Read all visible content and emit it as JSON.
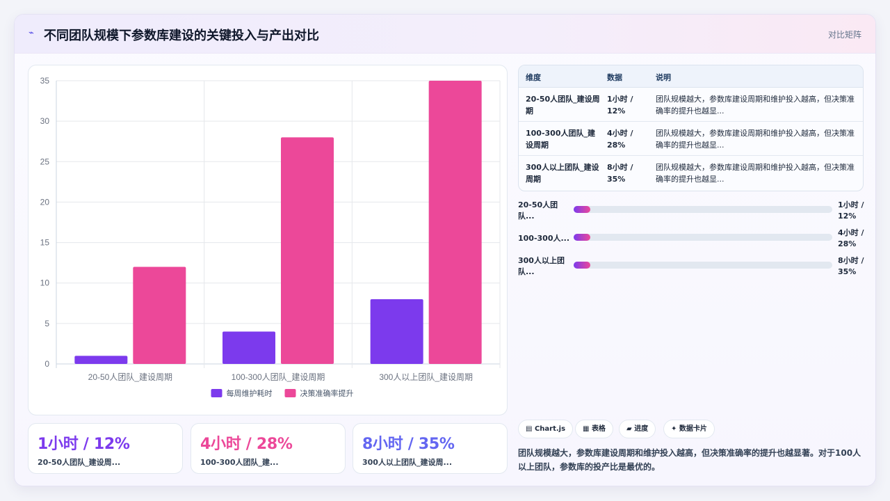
{
  "header": {
    "icon": "trend-arrow-icon",
    "title": "不同团队规模下参数库建设的关键投入与产出对比",
    "tag": "对比矩阵"
  },
  "chart_data": {
    "type": "bar",
    "categories": [
      "20-50人团队_建设周期",
      "100-300人团队_建设周期",
      "300人以上团队_建设周期"
    ],
    "series": [
      {
        "name": "每周维护耗时",
        "values": [
          1,
          4,
          8
        ],
        "color": "#7c3aed"
      },
      {
        "name": "决策准确率提升",
        "values": [
          12,
          28,
          35
        ],
        "color": "#ec4899"
      }
    ],
    "ylim": [
      0,
      35
    ],
    "yticks": [
      0,
      5,
      10,
      15,
      20,
      25,
      30,
      35
    ],
    "grid": true,
    "legend_position": "bottom"
  },
  "kpis": [
    {
      "value": "1小时 / 12%",
      "label": "20-50人团队_建设周...",
      "color": "#7c3aed"
    },
    {
      "value": "4小时 / 28%",
      "label": "100-300人团队_建...",
      "color": "#ec4899"
    },
    {
      "value": "8小时 / 35%",
      "label": "300人以上团队_建设周...",
      "color": "#6366f1"
    }
  ],
  "table": {
    "headers": [
      "维度",
      "数据",
      "说明"
    ],
    "rows": [
      {
        "dim": "20-50人团队_建设周期",
        "data": "1小时 / 12%",
        "desc": "团队规模越大，参数库建设周期和维护投入越高，但决策准确率的提升也越显..."
      },
      {
        "dim": "100-300人团队_建设周期",
        "data": "4小时 / 28%",
        "desc": "团队规模越大，参数库建设周期和维护投入越高，但决策准确率的提升也越显..."
      },
      {
        "dim": "300人以上团队_建设周期",
        "data": "8小时 / 35%",
        "desc": "团队规模越大，参数库建设周期和维护投入越高，但决策准确率的提升也越显..."
      }
    ]
  },
  "progress": [
    {
      "label": "20-50人团队...",
      "value": "1小时 / 12%",
      "fill_fraction": 0.065
    },
    {
      "label": "100-300人...",
      "value": "4小时 / 28%",
      "fill_fraction": 0.065
    },
    {
      "label": "300人以上团队...",
      "value": "8小时 / 35%",
      "fill_fraction": 0.065
    }
  ],
  "chips": [
    {
      "icon": "chart-icon",
      "glyph": "▤",
      "label": "Chart.js"
    },
    {
      "icon": "table-icon",
      "glyph": "▦",
      "label": "表格"
    },
    {
      "icon": "progress-icon",
      "glyph": "▰",
      "label": "进度"
    },
    {
      "icon": "sparkle-icon",
      "glyph": "✦",
      "label": "数据卡片"
    }
  ],
  "summary": "团队规模越大，参数库建设周期和维护投入越高，但决策准确率的提升也越显著。对于100人以上团队，参数库的投产比是最优的。"
}
